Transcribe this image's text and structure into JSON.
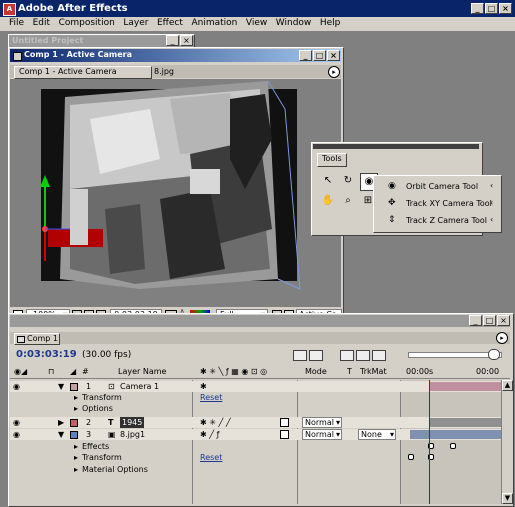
{
  "app": {
    "title": "Adobe After Effects"
  },
  "menu": [
    "File",
    "Edit",
    "Composition",
    "Layer",
    "Effect",
    "Animation",
    "View",
    "Window",
    "Help"
  ],
  "comp_window": {
    "title": "Comp 1 - Active Camera",
    "tabs": [
      "Comp 1 - Active Camera",
      "8.jpg"
    ],
    "footer": {
      "zoom": "100%",
      "timecode": "0:03:03:19",
      "resolution": "Full",
      "view": "Active Ca"
    }
  },
  "bg_window": {
    "title": "Untitled Project"
  },
  "tools_palette": {
    "tab": "Tools",
    "flyout": [
      "Orbit Camera Tool",
      "Track XY Camera Tool",
      "Track Z Camera Tool"
    ]
  },
  "timeline": {
    "tab": "Comp 1",
    "timecode": "0:03:03:19",
    "fps": "(30.00 fps)",
    "headers": {
      "num": "#",
      "layer_name": "Layer Name",
      "mode": "Mode",
      "t": "T",
      "trkmat": "TrkMat"
    },
    "ruler": [
      "00:00s",
      "00:00"
    ],
    "layers": [
      {
        "num": "1",
        "name": "Camera 1"
      },
      {
        "num": "2",
        "name": "1945",
        "mode": "Normal"
      },
      {
        "num": "3",
        "name": "8.jpg1",
        "mode": "Normal",
        "trkmat": "None"
      }
    ],
    "props": {
      "transform": "Transform",
      "options": "Options",
      "effects": "Effects",
      "material": "Material Options",
      "reset": "Reset"
    }
  },
  "colors": {
    "title_blue": "#0a246a",
    "timecode_blue": "#1c3a8c",
    "playhead": "#c00000"
  }
}
